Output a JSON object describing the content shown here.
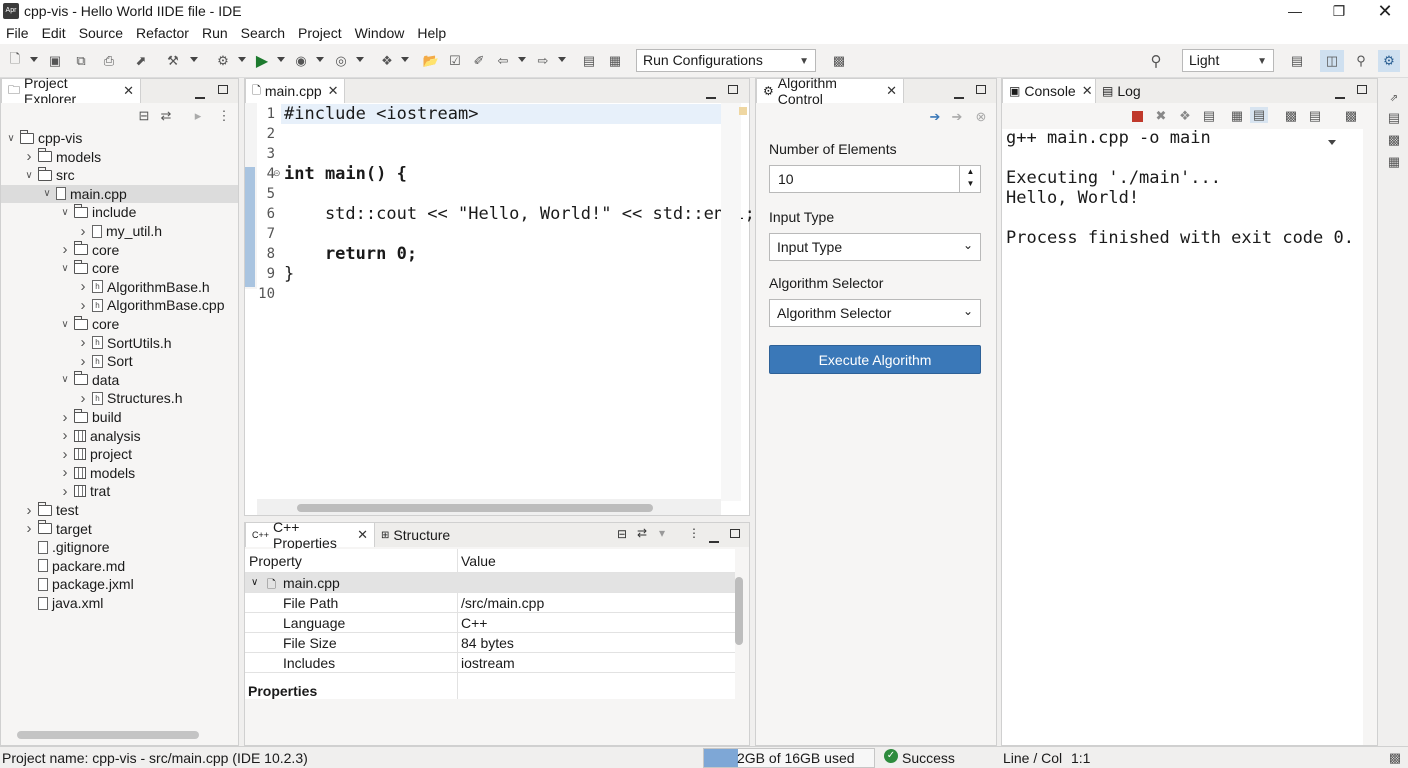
{
  "app": {
    "icon_text": "Apr",
    "title": "cpp-vis - Hello World IIDE file - IDE"
  },
  "menu": [
    "File",
    "Edit",
    "Source",
    "Refactor",
    "Run",
    "Search",
    "Project",
    "Window",
    "Help"
  ],
  "toolbar": {
    "run_config": "Run Configurations",
    "theme": "Light"
  },
  "explorer": {
    "tab": "Project Explorer",
    "items": [
      {
        "label": "cpp-vis",
        "icon": "project-icon"
      },
      {
        "label": "models",
        "icon": "folder-icon"
      },
      {
        "label": "src",
        "icon": "folder-icon"
      },
      {
        "label": "main.cpp",
        "icon": "file-icon"
      },
      {
        "label": "include",
        "icon": "folder-icon"
      },
      {
        "label": "my_util.h",
        "icon": "file-icon"
      },
      {
        "label": "core",
        "icon": "folder-icon"
      },
      {
        "label": "core",
        "icon": "folder-icon"
      },
      {
        "label": "AlgorithmBase.h",
        "icon": "header-file-icon"
      },
      {
        "label": "AlgorithmBase.cpp",
        "icon": "header-file-icon"
      },
      {
        "label": "core",
        "icon": "folder-icon"
      },
      {
        "label": "SortUtils.h",
        "icon": "header-file-icon"
      },
      {
        "label": "Sort",
        "icon": "header-file-icon"
      },
      {
        "label": "data",
        "icon": "folder-icon"
      },
      {
        "label": "Structures.h",
        "icon": "header-file-icon"
      },
      {
        "label": "build",
        "icon": "folder-icon"
      },
      {
        "label": "analysis",
        "icon": "package-icon"
      },
      {
        "label": "project",
        "icon": "package-icon"
      },
      {
        "label": "models",
        "icon": "package-icon"
      },
      {
        "label": "trat",
        "icon": "package-icon"
      },
      {
        "label": "test",
        "icon": "folder-icon"
      },
      {
        "label": "target",
        "icon": "folder-icon"
      },
      {
        "label": ".gitignore",
        "icon": "file-icon"
      },
      {
        "label": "packare.md",
        "icon": "file-icon"
      },
      {
        "label": "package.jxml",
        "icon": "file-icon"
      },
      {
        "label": "java.xml",
        "icon": "file-icon"
      }
    ]
  },
  "editor": {
    "tab": "main.cpp",
    "line_numbers": [
      "1",
      "2",
      "3",
      "4",
      "5",
      "6",
      "7",
      "8",
      "9",
      "10"
    ],
    "lines": [
      "#include <iostream>",
      "",
      "",
      "int main() {",
      "",
      "    std::cout << \"Hello, World!\" << std::endl;",
      "",
      "    return 0;",
      "}",
      ""
    ]
  },
  "properties": {
    "tab": "C++ Properties",
    "tab2": "Structure",
    "col_property": "Property",
    "col_value": "Value",
    "group": "main.cpp",
    "rows": [
      {
        "property": "File Path",
        "value": "/src/main.cpp"
      },
      {
        "property": "Language",
        "value": "C++"
      },
      {
        "property": "File Size",
        "value": "84 bytes"
      },
      {
        "property": "Includes",
        "value": "iostream"
      }
    ],
    "footer": "Properties"
  },
  "algorithm": {
    "tab": "Algorithm Control",
    "num_label": "Number of Elements",
    "num_value": "10",
    "input_label": "Input Type",
    "input_value": "Input Type",
    "selector_label": "Algorithm Selector",
    "selector_value": "Algorithm Selector",
    "execute": "Execute Algorithm",
    "accent": "#3a78b8"
  },
  "console": {
    "tab": "Console",
    "tab2": "Log",
    "lines": [
      "g++ main.cpp -o main",
      "",
      "Executing './main'...",
      "Hello, World!",
      "",
      "Process finished with exit code 0."
    ]
  },
  "status": {
    "project": "Project name: cpp-vis - src/main.cpp (IDE 10.2.3)",
    "memory": "2GB of 16GB used",
    "memory_fraction": 0.2,
    "result": "Success",
    "linecol_label": "Line / Col",
    "linecol": "1:1"
  }
}
